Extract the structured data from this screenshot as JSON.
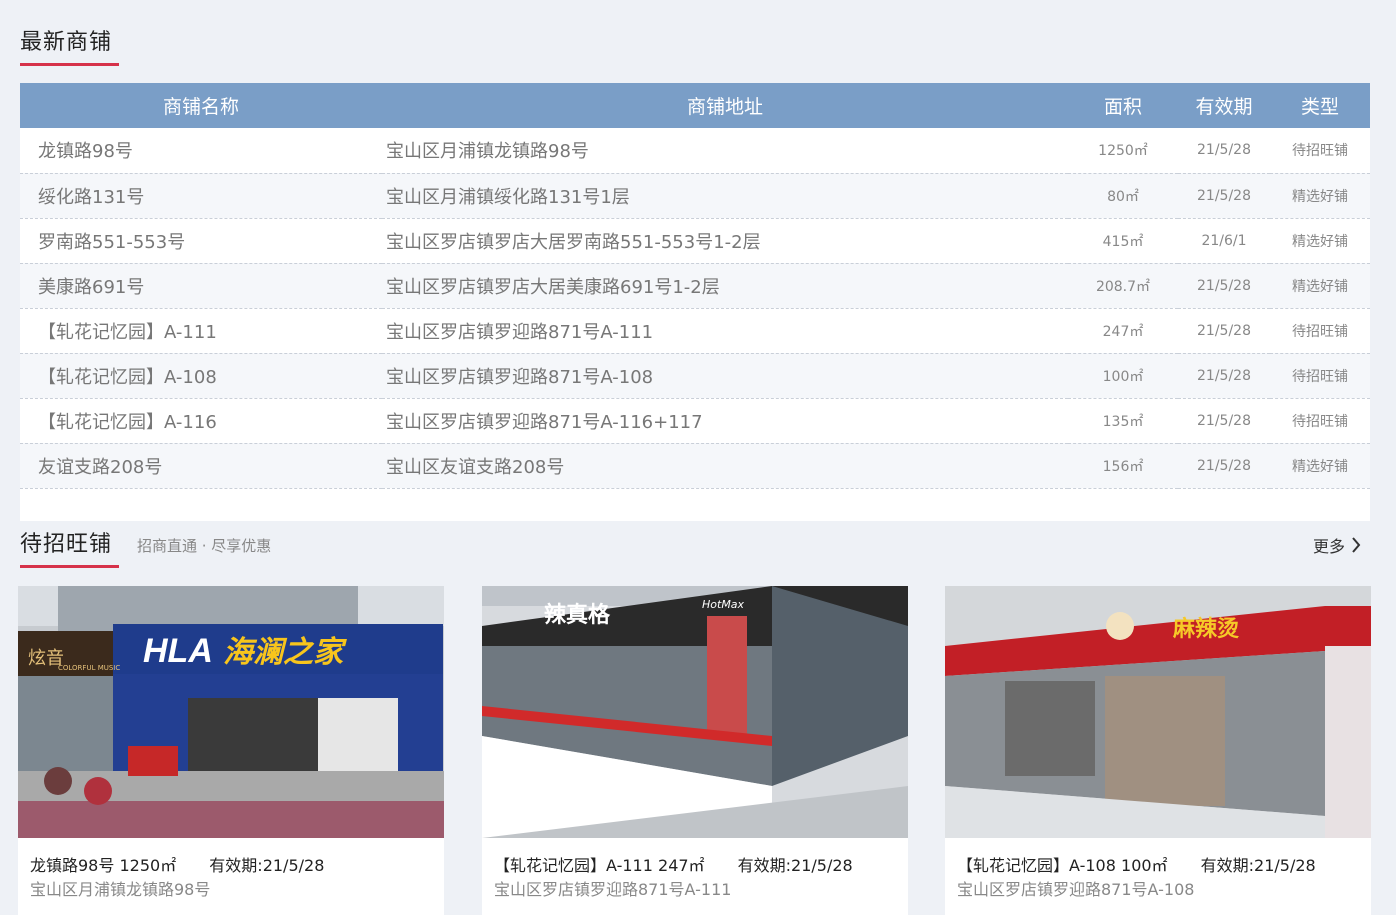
{
  "latest": {
    "title": "最新商铺",
    "headers": {
      "name": "商铺名称",
      "address": "商铺地址",
      "area": "面积",
      "validity": "有效期",
      "type": "类型"
    },
    "rows": [
      {
        "name": "龙镇路98号",
        "address": "宝山区月浦镇龙镇路98号",
        "area": "1250㎡",
        "validity": "21/5/28",
        "type": "待招旺铺"
      },
      {
        "name": "绥化路131号",
        "address": "宝山区月浦镇绥化路131号1层",
        "area": "80㎡",
        "validity": "21/5/28",
        "type": "精选好铺"
      },
      {
        "name": "罗南路551-553号",
        "address": "宝山区罗店镇罗店大居罗南路551-553号1-2层",
        "area": "415㎡",
        "validity": "21/6/1",
        "type": "精选好铺"
      },
      {
        "name": "美康路691号",
        "address": "宝山区罗店镇罗店大居美康路691号1-2层",
        "area": "208.7㎡",
        "validity": "21/5/28",
        "type": "精选好铺"
      },
      {
        "name": "【轧花记忆园】A-111",
        "address": "宝山区罗店镇罗迎路871号A-111",
        "area": "247㎡",
        "validity": "21/5/28",
        "type": "待招旺铺"
      },
      {
        "name": "【轧花记忆园】A-108",
        "address": "宝山区罗店镇罗迎路871号A-108",
        "area": "100㎡",
        "validity": "21/5/28",
        "type": "待招旺铺"
      },
      {
        "name": "【轧花记忆园】A-116",
        "address": "宝山区罗店镇罗迎路871号A-116+117",
        "area": "135㎡",
        "validity": "21/5/28",
        "type": "待招旺铺"
      },
      {
        "name": "友谊支路208号",
        "address": "宝山区友谊支路208号",
        "area": "156㎡",
        "validity": "21/5/28",
        "type": "精选好铺"
      }
    ]
  },
  "featured": {
    "title": "待招旺铺",
    "subtitle": "招商直通 · 尽享优惠",
    "more_label": "更多",
    "cards": [
      {
        "name": "龙镇路98号",
        "area": "1250㎡",
        "validity": "有效期:21/5/28",
        "address": "宝山区月浦镇龙镇路98号",
        "sign_left": "炫音",
        "sign_left_sub": "COLORFUL MUSIC",
        "sign_brand": "HLA",
        "sign_text": "海澜之家"
      },
      {
        "name": "【轧花记忆园】A-111",
        "area": "247㎡",
        "validity": "有效期:21/5/28",
        "address": "宝山区罗店镇罗迎路871号A-111",
        "sign_text": "辣真格",
        "sign_brand": "HotMax"
      },
      {
        "name": "【轧花记忆园】A-108",
        "area": "100㎡",
        "validity": "有效期:21/5/28",
        "address": "宝山区罗店镇罗迎路871号A-108",
        "sign_text": "麻辣烫"
      }
    ]
  },
  "colors": {
    "accent": "#d6324a",
    "header_bg": "#7a9ec7",
    "page_bg": "#eef1f6"
  },
  "icons": {
    "more": "chevron-right-icon"
  }
}
